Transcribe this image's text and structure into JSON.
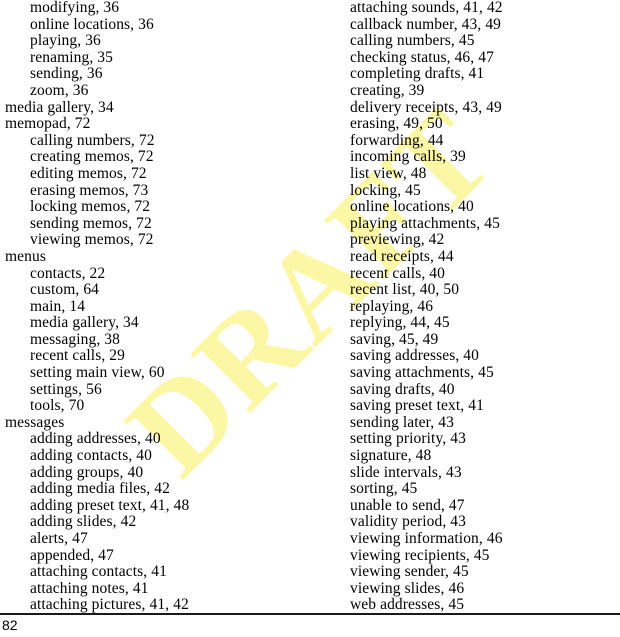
{
  "document": {
    "kind": "index",
    "page_number": "82",
    "watermark": {
      "text": "DRAFT",
      "color": "#fbf7a5",
      "rotation_degrees": -45
    }
  },
  "columns": [
    {
      "name": "left",
      "entries": [
        {
          "level": 1,
          "text": "modifying, 36"
        },
        {
          "level": 1,
          "text": "online locations, 36"
        },
        {
          "level": 1,
          "text": "playing, 36"
        },
        {
          "level": 1,
          "text": "renaming, 35"
        },
        {
          "level": 1,
          "text": "sending, 36"
        },
        {
          "level": 1,
          "text": "zoom, 36"
        },
        {
          "level": 0,
          "text": "media gallery, 34"
        },
        {
          "level": 0,
          "text": "memopad, 72"
        },
        {
          "level": 1,
          "text": "calling numbers, 72"
        },
        {
          "level": 1,
          "text": "creating memos, 72"
        },
        {
          "level": 1,
          "text": "editing memos, 72"
        },
        {
          "level": 1,
          "text": "erasing memos, 73"
        },
        {
          "level": 1,
          "text": "locking memos, 72"
        },
        {
          "level": 1,
          "text": "sending memos, 72"
        },
        {
          "level": 1,
          "text": "viewing memos, 72"
        },
        {
          "level": 0,
          "text": "menus"
        },
        {
          "level": 1,
          "text": "contacts, 22"
        },
        {
          "level": 1,
          "text": "custom, 64"
        },
        {
          "level": 1,
          "text": "main, 14"
        },
        {
          "level": 1,
          "text": "media gallery, 34"
        },
        {
          "level": 1,
          "text": "messaging, 38"
        },
        {
          "level": 1,
          "text": "recent calls, 29"
        },
        {
          "level": 1,
          "text": "setting main view, 60"
        },
        {
          "level": 1,
          "text": "settings, 56"
        },
        {
          "level": 1,
          "text": "tools, 70"
        },
        {
          "level": 0,
          "text": "messages"
        },
        {
          "level": 1,
          "text": "adding addresses, 40"
        },
        {
          "level": 1,
          "text": "adding contacts, 40"
        },
        {
          "level": 1,
          "text": "adding groups, 40"
        },
        {
          "level": 1,
          "text": "adding media files, 42"
        },
        {
          "level": 1,
          "text": "adding preset text, 41, 48"
        },
        {
          "level": 1,
          "text": "adding slides, 42"
        },
        {
          "level": 1,
          "text": "alerts, 47"
        },
        {
          "level": 1,
          "text": "appended, 47"
        },
        {
          "level": 1,
          "text": "attaching contacts, 41"
        },
        {
          "level": 1,
          "text": "attaching notes, 41"
        },
        {
          "level": 1,
          "text": "attaching pictures, 41, 42"
        }
      ]
    },
    {
      "name": "right",
      "entries": [
        {
          "level": 0,
          "text": "attaching sounds, 41, 42"
        },
        {
          "level": 0,
          "text": "callback number, 43, 49"
        },
        {
          "level": 0,
          "text": "calling numbers, 45"
        },
        {
          "level": 0,
          "text": "checking status, 46, 47"
        },
        {
          "level": 0,
          "text": "completing drafts, 41"
        },
        {
          "level": 0,
          "text": "creating, 39"
        },
        {
          "level": 0,
          "text": "delivery receipts, 43, 49"
        },
        {
          "level": 0,
          "text": "erasing, 49, 50"
        },
        {
          "level": 0,
          "text": "forwarding, 44"
        },
        {
          "level": 0,
          "text": "incoming calls, 39"
        },
        {
          "level": 0,
          "text": "list view, 48"
        },
        {
          "level": 0,
          "text": "locking, 45"
        },
        {
          "level": 0,
          "text": "online locations, 40"
        },
        {
          "level": 0,
          "text": "playing attachments, 45"
        },
        {
          "level": 0,
          "text": "previewing, 42"
        },
        {
          "level": 0,
          "text": "read receipts, 44"
        },
        {
          "level": 0,
          "text": "recent calls, 40"
        },
        {
          "level": 0,
          "text": "recent list, 40, 50"
        },
        {
          "level": 0,
          "text": "replaying, 46"
        },
        {
          "level": 0,
          "text": "replying, 44, 45"
        },
        {
          "level": 0,
          "text": "saving, 45, 49"
        },
        {
          "level": 0,
          "text": "saving addresses, 40"
        },
        {
          "level": 0,
          "text": "saving attachments, 45"
        },
        {
          "level": 0,
          "text": "saving drafts, 40"
        },
        {
          "level": 0,
          "text": "saving preset text, 41"
        },
        {
          "level": 0,
          "text": "sending later, 43"
        },
        {
          "level": 0,
          "text": "setting priority, 43"
        },
        {
          "level": 0,
          "text": "signature, 48"
        },
        {
          "level": 0,
          "text": "slide intervals, 43"
        },
        {
          "level": 0,
          "text": "sorting, 45"
        },
        {
          "level": 0,
          "text": "unable to send, 47"
        },
        {
          "level": 0,
          "text": "validity period, 43"
        },
        {
          "level": 0,
          "text": "viewing information, 46"
        },
        {
          "level": 0,
          "text": "viewing recipients, 45"
        },
        {
          "level": 0,
          "text": "viewing sender, 45"
        },
        {
          "level": 0,
          "text": "viewing slides, 46"
        },
        {
          "level": 0,
          "text": "web addresses, 45"
        }
      ]
    }
  ]
}
